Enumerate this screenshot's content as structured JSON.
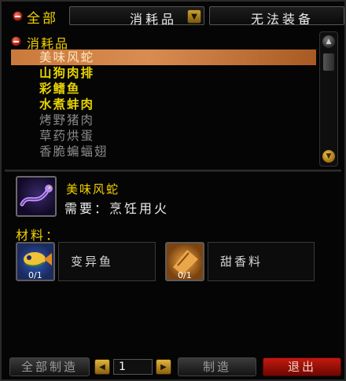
{
  "header": {
    "category_all_label": "全部",
    "category_dropdown": "消耗品",
    "filter_dropdown": "无法装备"
  },
  "list": {
    "category_label": "消耗品",
    "recipes": [
      {
        "name": "美味风蛇",
        "state": "selected"
      },
      {
        "name": "山狗肉排",
        "state": "available"
      },
      {
        "name": "彩鳍鱼",
        "state": "available"
      },
      {
        "name": "水煮蚌肉",
        "state": "available"
      },
      {
        "name": "烤野猪肉",
        "state": "unavailable"
      },
      {
        "name": "草药烘蛋",
        "state": "unavailable"
      },
      {
        "name": "香脆蝙蝠翅",
        "state": "unavailable"
      }
    ]
  },
  "detail": {
    "name": "美味风蛇",
    "requires": "需要：烹饪用火",
    "materials_title": "材料：",
    "materials": [
      {
        "name": "变异鱼",
        "count": "0/1",
        "icon": "fish-icon"
      },
      {
        "name": "甜香料",
        "count": "0/1",
        "icon": "spice-pouch-icon"
      }
    ]
  },
  "footer": {
    "create_all_label": "全部制造",
    "quantity": "1",
    "create_label": "制造",
    "exit_label": "退出"
  },
  "colors": {
    "title_yellow": "#f2d100",
    "selected_row": "#c97a3b",
    "unavailable_gray": "#8a8a8a",
    "exit_red": "#c21a0f"
  }
}
